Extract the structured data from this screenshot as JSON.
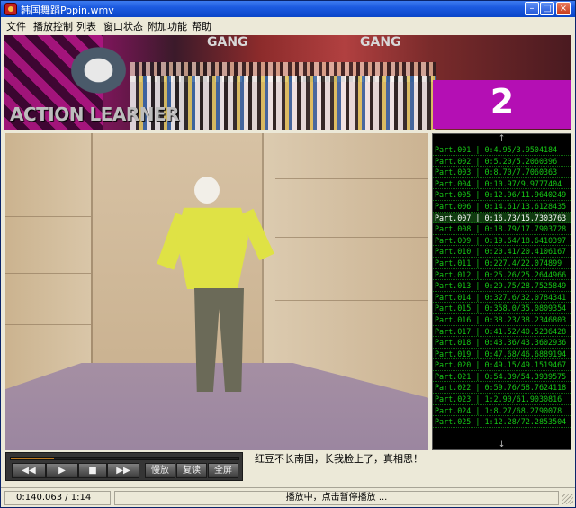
{
  "window": {
    "title": "韩国舞蹈Popin.wmv"
  },
  "titlebar_buttons": {
    "minimize": "–",
    "maximize": "□",
    "close": "×"
  },
  "menu": [
    "文件",
    "播放控制",
    "列表",
    "窗口状态",
    "附加功能",
    "帮助"
  ],
  "banner": {
    "brand_text_1": "GANG",
    "brand_text_2": "GANG",
    "logo_text": "ACTION LEARNER",
    "number": "2"
  },
  "part_list": {
    "scroll_up": "↑",
    "scroll_down": "↓",
    "selected_index": 6,
    "items": [
      "Part.001 | 0:4.95/3.9504184",
      "Part.002 | 0:5.20/5.2060396",
      "Part.003 | 0:8.70/7.7060363",
      "Part.004 | 0:10.97/9.9777404",
      "Part.005 | 0:12.96/11.9640249",
      "Part.006 | 0:14.61/13.6128435",
      "Part.007 | 0:16.73/15.7303763",
      "Part.008 | 0:18.79/17.7903728",
      "Part.009 | 0:19.64/18.6410397",
      "Part.010 | 0:20.41/20.4106167",
      "Part.011 | 0:227.4/22.074899",
      "Part.012 | 0:25.26/25.2644966",
      "Part.013 | 0:29.75/28.7525849",
      "Part.014 | 0:327.6/32.0784341",
      "Part.015 | 0:358.0/35.0809354",
      "Part.016 | 0:38.23/38.2346803",
      "Part.017 | 0:41.52/40.5236428",
      "Part.018 | 0:43.36/43.3602936",
      "Part.019 | 0:47.68/46.6889194",
      "Part.020 | 0:49.15/49.1519467",
      "Part.021 | 0:54.39/54.3939575",
      "Part.022 | 0:59.76/58.7624118",
      "Part.023 | 1:2.90/61.9030816",
      "Part.024 | 1:8.27/68.2790078",
      "Part.025 | 1:12.28/72.2853504"
    ]
  },
  "controls": {
    "rewind": "◀◀",
    "play": "▶",
    "stop": "■",
    "forward": "▶▶",
    "slow": "慢放",
    "repeat": "复读",
    "fullscreen": "全屏",
    "progress": 0.19
  },
  "subtitle": "红豆不长南国，长我脸上了，真相思！",
  "status": {
    "time": "0:140.063 / 1:14",
    "message": "播放中，点击暂停播放 ..."
  }
}
